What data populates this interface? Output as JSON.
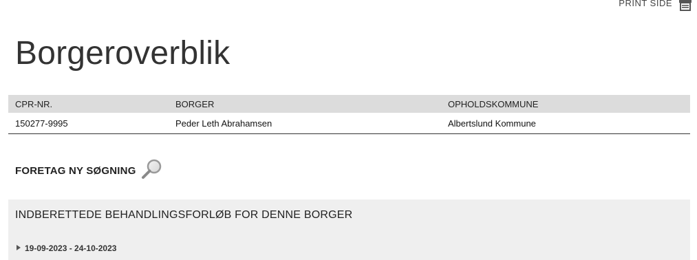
{
  "header": {
    "print_label": "PRINT SIDE",
    "print_icon": "printer-icon"
  },
  "page": {
    "title": "Borgeroverblik"
  },
  "citizen_table": {
    "columns": [
      "CPR-NR.",
      "BORGER",
      "OPHOLDSKOMMUNE"
    ],
    "rows": [
      [
        "150277-9995",
        "Peder Leth Abrahamsen",
        "Albertslund Kommune"
      ]
    ]
  },
  "search": {
    "label": "FORETAG NY SØGNING",
    "icon": "search-icon"
  },
  "panel": {
    "title": "INDBERETTEDE BEHANDLINGSFORLØB FOR DENNE BORGER",
    "items": [
      {
        "date_range": "19-09-2023 - 24-10-2023",
        "icon": "triangle-right-icon"
      }
    ]
  },
  "colors": {
    "table_header_bg": "#dcdcdc",
    "panel_bg": "#efefef",
    "text": "#222222"
  }
}
